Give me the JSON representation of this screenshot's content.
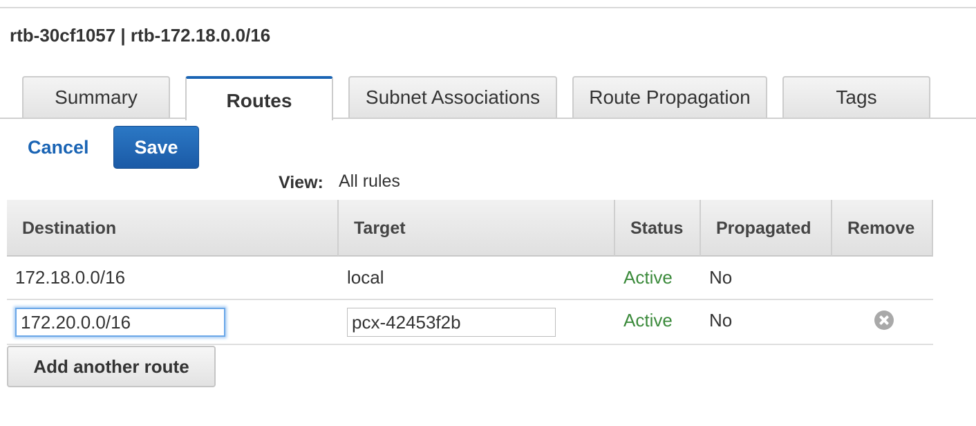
{
  "page_title": "rtb-30cf1057 | rtb-172.18.0.0/16",
  "tabs": [
    {
      "label": "Summary",
      "active": false
    },
    {
      "label": "Routes",
      "active": true
    },
    {
      "label": "Subnet Associations",
      "active": false
    },
    {
      "label": "Route Propagation",
      "active": false
    },
    {
      "label": "Tags",
      "active": false
    }
  ],
  "actions": {
    "cancel_label": "Cancel",
    "save_label": "Save"
  },
  "view": {
    "label": "View:",
    "value": "All rules"
  },
  "table": {
    "columns": [
      "Destination",
      "Target",
      "Status",
      "Propagated",
      "Remove"
    ],
    "rows": [
      {
        "destination": "172.18.0.0/16",
        "target": "local",
        "status": "Active",
        "propagated": "No",
        "removable": false
      },
      {
        "destination": "172.20.0.0/16",
        "target": "pcx-42453f2b",
        "status": "Active",
        "propagated": "No",
        "removable": true
      }
    ]
  },
  "add_route_label": "Add another route",
  "colors": {
    "accent": "#1a64b4",
    "active_status": "#3b8a3b",
    "focus_ring": "#6aa7e8"
  },
  "icons": {
    "remove": "remove-circle-x-icon"
  }
}
